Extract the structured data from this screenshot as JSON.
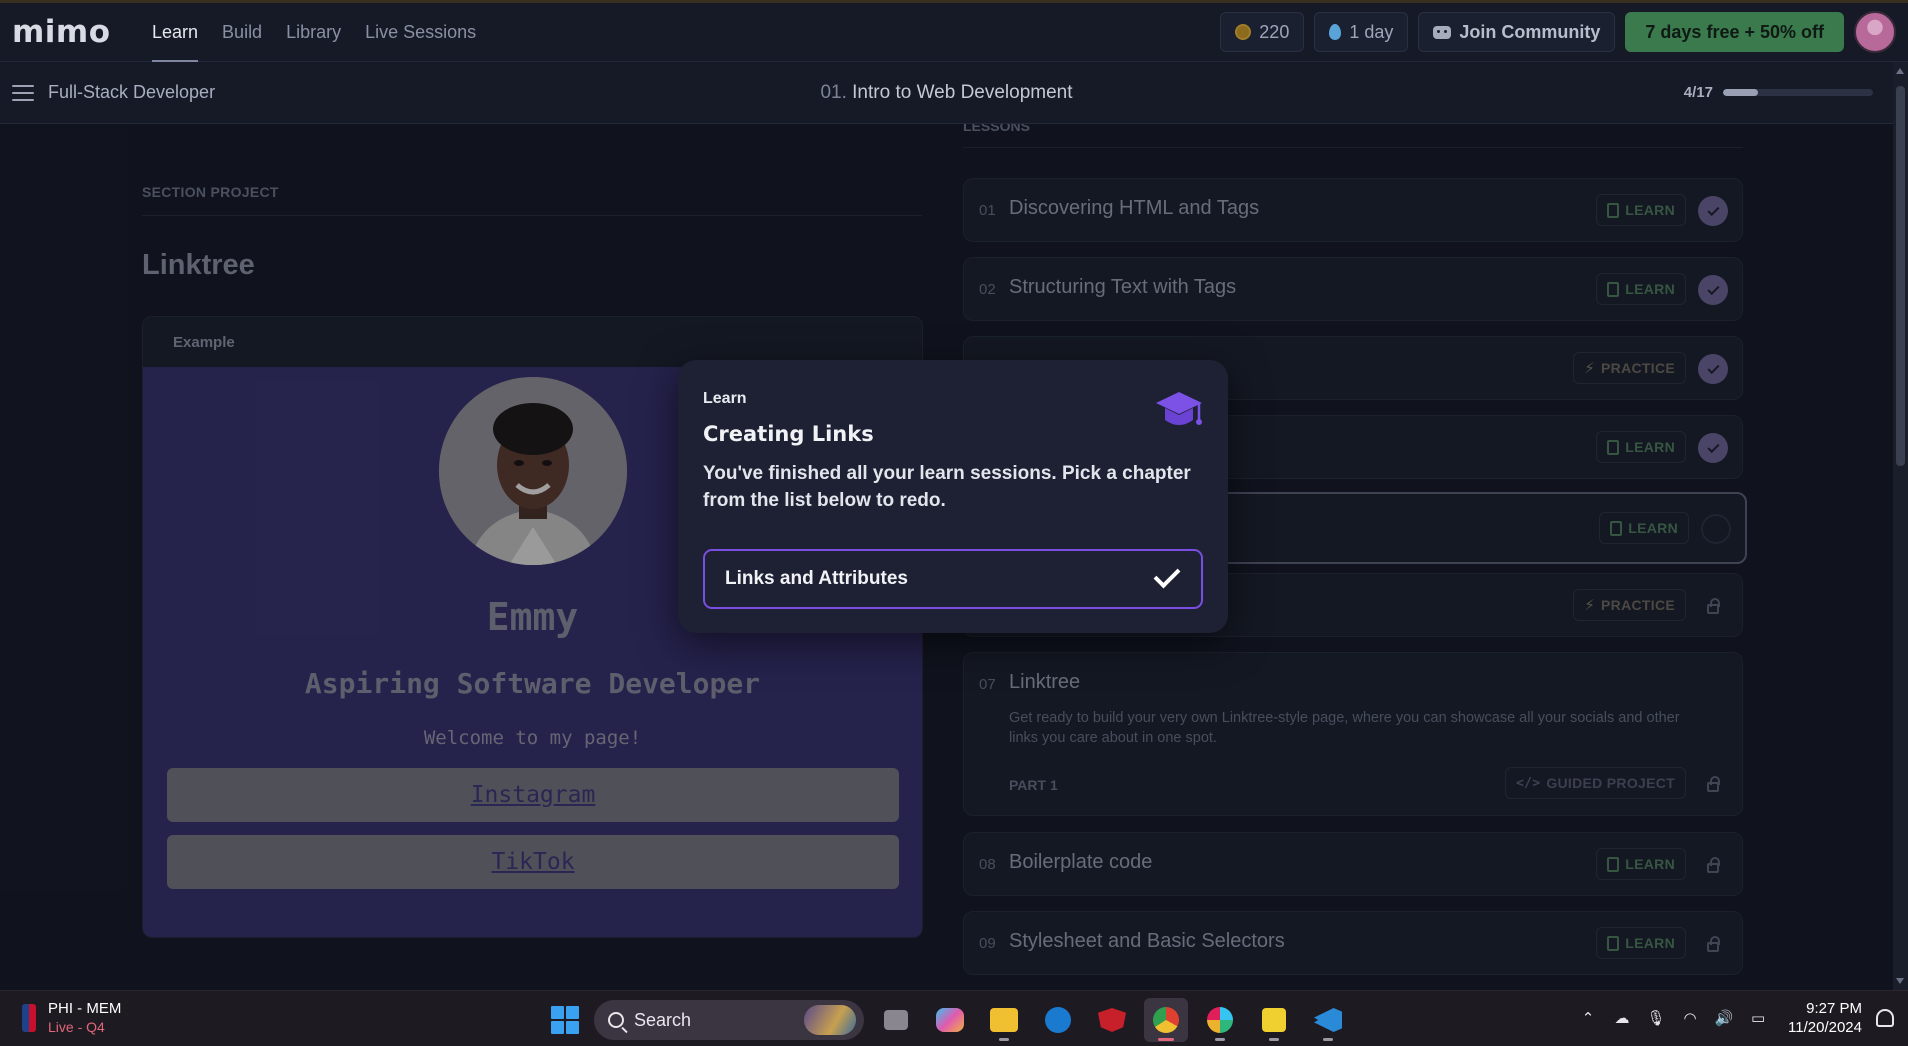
{
  "topbar": {
    "logo": "mimo",
    "nav": [
      "Learn",
      "Build",
      "Library",
      "Live Sessions"
    ],
    "coins": "220",
    "streak": "1 day",
    "community": "Join Community",
    "promo": "7 days free + 50% off"
  },
  "subbar": {
    "course": "Full-Stack Developer",
    "chapter_num": "01.",
    "chapter_title": "Intro to Web Development",
    "progress_text": "4/17",
    "progress_fraction": 0.235
  },
  "left": {
    "section_label": "SECTION PROJECT",
    "project_title": "Linktree",
    "example_label": "Example",
    "name": "Emmy",
    "subtitle": "Aspiring Software Developer",
    "welcome": "Welcome to my page!",
    "links": [
      "Instagram",
      "TikTok"
    ]
  },
  "lessons": {
    "label": "LESSONS",
    "items": [
      {
        "num": "01",
        "title": "Discovering HTML and Tags",
        "badge": "LEARN",
        "status": "done"
      },
      {
        "num": "02",
        "title": "Structuring Text with Tags",
        "badge": "LEARN",
        "status": "done"
      },
      {
        "num": "",
        "title": "",
        "badge": "PRACTICE",
        "status": "done"
      },
      {
        "num": "",
        "title": "",
        "badge": "LEARN",
        "status": "done"
      },
      {
        "num": "",
        "title": "",
        "badge": "LEARN",
        "status": "empty"
      },
      {
        "num": "",
        "title": "",
        "badge": "PRACTICE",
        "status": "locked"
      }
    ],
    "project": {
      "num": "07",
      "title": "Linktree",
      "description": "Get ready to build your very own Linktree-style page, where you can showcase all your socials and other links you care about in one spot.",
      "part": "PART 1",
      "badge": "GUIDED PROJECT"
    },
    "after": [
      {
        "num": "08",
        "title": "Boilerplate code",
        "badge": "LEARN",
        "status": "locked"
      },
      {
        "num": "09",
        "title": "Stylesheet and Basic Selectors",
        "badge": "LEARN",
        "status": "locked"
      }
    ]
  },
  "popover": {
    "eyebrow": "Learn",
    "title": "Creating Links",
    "description": "You've finished all your learn sessions. Pick a chapter from the list below to redo.",
    "option": "Links and Attributes"
  },
  "taskbar": {
    "news_title": "PHI - MEM",
    "news_sub": "Live - Q4",
    "search": "Search",
    "time": "9:27 PM",
    "date": "11/20/2024"
  },
  "colors": {
    "accent_purple": "#7a4ee0",
    "promo_green": "#3a7a4d",
    "example_bg": "#352f6a"
  }
}
